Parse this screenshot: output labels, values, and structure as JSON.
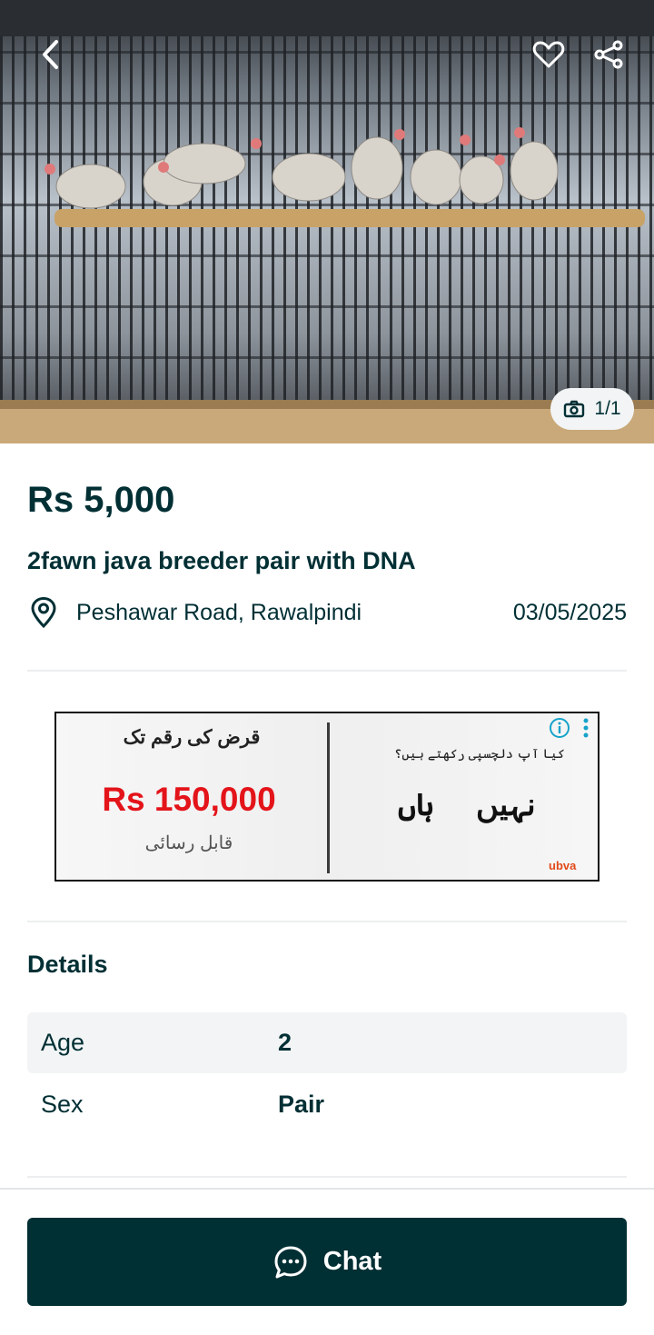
{
  "gallery": {
    "photo_counter": "1/1"
  },
  "listing": {
    "price": "Rs 5,000",
    "title": "2fawn java breeder pair with DNA",
    "location": "Peshawar Road, Rawalpindi",
    "date": "03/05/2025"
  },
  "ad": {
    "heading": "قرض کی رقم تک",
    "amount": "Rs 150,000",
    "subtext": "قابل رسائی",
    "question": "کیا آپ دلچسپی رکھتے ہیں؟",
    "no_label": "نہیں",
    "yes_label": "ہاں",
    "brand": "ubva"
  },
  "details": {
    "heading": "Details",
    "rows": [
      {
        "key": "Age",
        "value": "2"
      },
      {
        "key": "Sex",
        "value": "Pair"
      }
    ]
  },
  "footer": {
    "chat_label": "Chat"
  },
  "colors": {
    "primary": "#002f34",
    "ad_red": "#e3141a",
    "row_shade": "#f2f4f5"
  }
}
